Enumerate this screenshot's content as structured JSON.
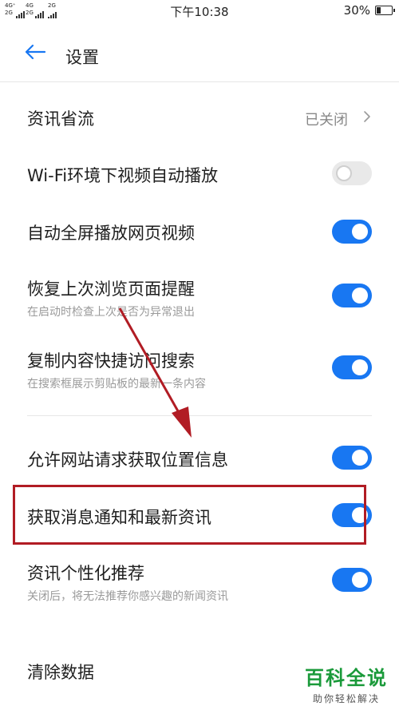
{
  "status_bar": {
    "signal1_label": "4G⁺",
    "signal1b_label": "2G",
    "signal2_label": "4G",
    "signal2b_label": "2G",
    "signal3_label": "2G",
    "time": "下午10:38",
    "battery_percent": "30%",
    "battery_level": 0.3
  },
  "header": {
    "back_icon": "arrow-left-icon",
    "title": "设置"
  },
  "settings": {
    "data_saver": {
      "label": "资讯省流",
      "value": "已关闭"
    },
    "wifi_autoplay": {
      "label": "Wi-Fi环境下视频自动播放",
      "enabled": false
    },
    "fullscreen_video": {
      "label": "自动全屏播放网页视频",
      "enabled": true
    },
    "restore_reminder": {
      "label": "恢复上次浏览页面提醒",
      "sub": "在启动时检查上次是否为异常退出",
      "enabled": true
    },
    "clipboard_search": {
      "label": "复制内容快捷访问搜索",
      "sub": "在搜索框展示剪贴板的最新一条内容",
      "enabled": true
    },
    "location": {
      "label": "允许网站请求获取位置信息",
      "enabled": true
    },
    "notifications": {
      "label": "获取消息通知和最新资讯",
      "enabled": true
    },
    "personalized": {
      "label": "资讯个性化推荐",
      "sub": "关闭后，将无法推荐你感兴趣的新闻资讯",
      "enabled": true
    },
    "clear_data": {
      "label": "清除数据"
    }
  },
  "colors": {
    "accent": "#1877f2",
    "annotation": "#b11c24",
    "watermark": "#1a9a3a"
  },
  "watermark": {
    "title": "百科全说",
    "subtitle": "助你轻松解决"
  }
}
